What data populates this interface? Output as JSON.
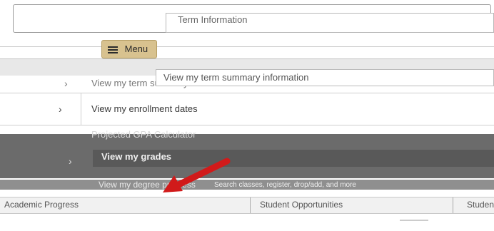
{
  "header": {
    "term_tab": "Term Information",
    "menu_label": "Menu"
  },
  "rows": [
    {
      "label": "View my term summary information",
      "ghost": "View my term summary information"
    },
    {
      "label": "View my enrollment dates"
    },
    {
      "label": "Projected GPA Calculator",
      "sub": "View my grades"
    },
    {
      "label": "View my degree progress",
      "sub": "Search classes, register, drop/add, and more"
    }
  ],
  "bottom_bar": {
    "left_item": "Academic Progress",
    "center_item": "Student Opportunities",
    "right_item": "Student"
  },
  "colors": {
    "menu_button": "#d8c28f",
    "selected_row": "#595959",
    "arrow": "#d11a1a"
  },
  "icons": [
    "hamburger-icon",
    "chevron-right-icon",
    "red-arrow-annotation"
  ]
}
